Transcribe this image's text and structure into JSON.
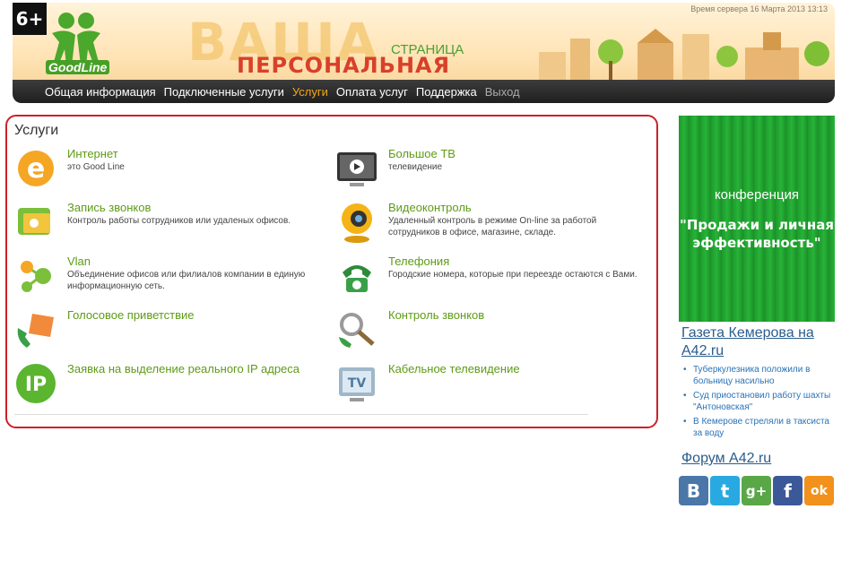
{
  "header": {
    "age_badge": "6+",
    "logo_text": "GoodLine",
    "server_time": "Время сервера 16 Марта 2013 13:13",
    "banner_big": "ВАША",
    "banner_stranica": "СТРАНИЦА",
    "banner_personal": "ПЕРСОНАЛЬНАЯ"
  },
  "nav": {
    "items": [
      {
        "label": "Общая информация"
      },
      {
        "label": "Подключенные услуги"
      },
      {
        "label": "Услуги"
      },
      {
        "label": "Оплата услуг"
      },
      {
        "label": "Поддержка"
      },
      {
        "label": "Выход"
      }
    ],
    "active": "Услуги"
  },
  "services": {
    "title": "Услуги",
    "items": [
      {
        "name": "Интернет",
        "desc": "это Good Line",
        "icon": "internet-icon"
      },
      {
        "name": "Большое ТВ",
        "desc": "телевидение",
        "icon": "tv-monitor-icon"
      },
      {
        "name": "Запись звонков",
        "desc": "Контроль работы сотрудников или удаленых офисов.",
        "icon": "call-recording-icon"
      },
      {
        "name": "Видеоконтроль",
        "desc": "Удаленный контроль в режиме On-line за работой сотрудников в офисе, магазине, складе.",
        "icon": "webcam-icon"
      },
      {
        "name": "Vlan",
        "desc": "Объединение офисов или филиалов компании в единую информационную сеть.",
        "icon": "network-icon"
      },
      {
        "name": "Телефония",
        "desc": "Городские номера, которые при переезде остаются с Вами.",
        "icon": "phone-icon"
      },
      {
        "name": "Голосовое приветствие",
        "desc": "",
        "icon": "voice-greeting-icon"
      },
      {
        "name": "Контроль звонков",
        "desc": "",
        "icon": "call-control-icon"
      },
      {
        "name": "Заявка на выделение реального IP адреса",
        "desc": "",
        "icon": "ip-icon"
      },
      {
        "name": "Кабельное телевидение",
        "desc": "",
        "icon": "cable-tv-icon"
      }
    ]
  },
  "ad": {
    "line1": "конференция",
    "line2": "\"Продажи и личная эффективность\""
  },
  "news": {
    "title": "Газета Кемерова на A42.ru",
    "items": [
      "Туберкулезника положили в больницу насильно",
      "Суд приостановил работу шахты \"Антоновская\"",
      "В Кемерове стреляли в таксиста за воду"
    ]
  },
  "forum": {
    "title": "Форум A42.ru"
  },
  "social": [
    {
      "label": "В",
      "icon": "vk-icon",
      "color": "#4a76a8"
    },
    {
      "label": "t",
      "icon": "twitter-icon",
      "color": "#29a9e1"
    },
    {
      "label": "g+",
      "icon": "google-icon",
      "color": "#5aa748"
    },
    {
      "label": "f",
      "icon": "facebook-icon",
      "color": "#3b5998"
    },
    {
      "label": "ok",
      "icon": "odnoklassniki-icon",
      "color": "#f2911b"
    }
  ],
  "colors": {
    "accent": "#f6a516",
    "link_green": "#5e9b16",
    "panel_border": "#cc2029",
    "ad_green": "#1e9a2c"
  }
}
